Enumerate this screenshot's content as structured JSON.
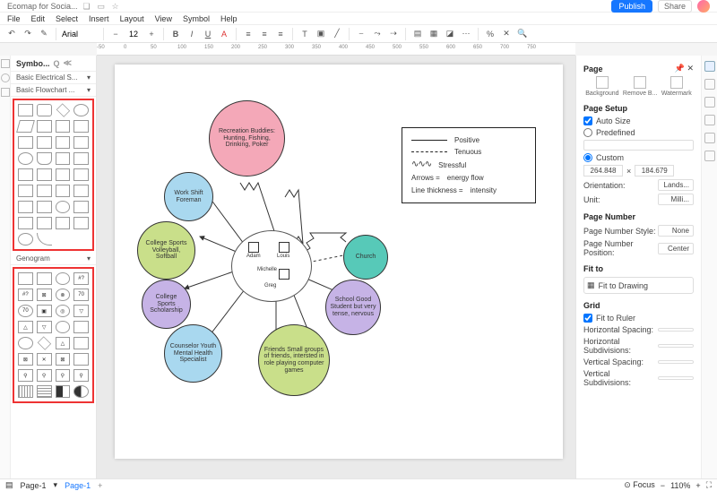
{
  "title": "Ecomap for Socia...",
  "menu": [
    "File",
    "Edit",
    "Select",
    "Insert",
    "Layout",
    "View",
    "Symbol",
    "Help"
  ],
  "toolbar": {
    "font": "Arial",
    "size": "12"
  },
  "publish": "Publish",
  "share": "Share",
  "symbols": {
    "title": "Symbo...",
    "sections": [
      "Basic Electrical S...",
      "Basic Flowchart ...",
      "Genogram"
    ]
  },
  "ruler_ticks": [
    "-50",
    "0",
    "50",
    "100",
    "150",
    "200",
    "250",
    "300",
    "350",
    "400",
    "450",
    "500",
    "550",
    "600",
    "650",
    "700",
    "750"
  ],
  "legend": {
    "positive": "Positive",
    "tenuous": "Tenuous",
    "stressful": "Stressful",
    "arrows": "Arrows =",
    "arrows_v": "energy flow",
    "thickness": "Line thickness =",
    "thickness_v": "intensity"
  },
  "nodes": {
    "recreation": "Recreation Buddies: Hunting, Fishing, Drinking, Poker",
    "workshift": "Work Shift Foreman",
    "collegesports": "College Sports Volleyball, Softball",
    "scholarship": "College Sports Scholarship",
    "counselor": "Counselor Youth Mental Health Specialist",
    "friends": "Friends Small groups of friends, intersted in role playing computer games",
    "school": "School Good Student but very tense, nervous",
    "church": "Church"
  },
  "family": {
    "adam": "Adam",
    "louis": "Louis",
    "michelle": "Michelle",
    "greg": "Greg"
  },
  "panel": {
    "title": "Page",
    "topbtns": [
      "Background",
      "Remove B...",
      "Watermark"
    ],
    "setup": "Page Setup",
    "autosize": "Auto Size",
    "predefined": "Predefined",
    "custom": "Custom",
    "w": "264.848",
    "h": "184.679",
    "orientation_l": "Orientation:",
    "orientation_v": "Lands...",
    "unit_l": "Unit:",
    "unit_v": "Milli...",
    "pagenum": "Page Number",
    "pns_l": "Page Number Style:",
    "pns_v": "None",
    "pnp_l": "Page Number Position:",
    "pnp_v": "Center",
    "fitto": "Fit to",
    "fitdraw": "Fit to Drawing",
    "grid": "Grid",
    "fitruler": "Fit to Ruler",
    "hspacing": "Horizontal Spacing:",
    "hsub": "Horizontal Subdivisions:",
    "vspacing": "Vertical Spacing:",
    "vsub": "Vertical Subdivisions:"
  },
  "status": {
    "page_l": "Page-1",
    "page_tab": "Page-1",
    "focus": "Focus",
    "zoom": "110%"
  },
  "chart_data": {
    "type": "diagram-ecomap",
    "center_family": [
      "Adam",
      "Louis",
      "Michelle",
      "Greg"
    ],
    "external_systems": [
      {
        "name": "Recreation Buddies: Hunting, Fishing, Drinking, Poker",
        "color": "#f4a8b8"
      },
      {
        "name": "Work Shift Foreman",
        "color": "#a9d8ef"
      },
      {
        "name": "College Sports Volleyball, Softball",
        "color": "#c9df8a"
      },
      {
        "name": "College Sports Scholarship",
        "color": "#c6b3e6"
      },
      {
        "name": "Counselor Youth Mental Health Specialist",
        "color": "#a9d8ef"
      },
      {
        "name": "Friends (role playing computer games)",
        "color": "#c9df8a"
      },
      {
        "name": "School Good Student but very tense, nervous",
        "color": "#c6b3e6"
      },
      {
        "name": "Church",
        "color": "#57c9b8"
      }
    ],
    "relationships": [
      {
        "from": "Adam",
        "to": "Recreation Buddies",
        "type": "stressful",
        "direction": "both"
      },
      {
        "from": "Adam",
        "to": "Work Shift Foreman",
        "type": "positive",
        "direction": "to-center"
      },
      {
        "from": "Louis",
        "to": "Recreation Buddies",
        "type": "stressful",
        "direction": "from-center"
      },
      {
        "from": "Louis",
        "to": "Church",
        "type": "stressful",
        "direction": "both"
      },
      {
        "from": "Michelle",
        "to": "College Sports",
        "type": "positive",
        "direction": "to-center"
      },
      {
        "from": "Michelle",
        "to": "Scholarship",
        "type": "positive",
        "direction": "to-center"
      },
      {
        "from": "Michelle",
        "to": "Counselor",
        "type": "positive",
        "direction": "both"
      },
      {
        "from": "Greg",
        "to": "Counselor",
        "type": "positive",
        "direction": "both"
      },
      {
        "from": "Greg",
        "to": "Friends",
        "type": "positive",
        "direction": "from-center"
      },
      {
        "from": "Greg",
        "to": "School",
        "type": "positive",
        "direction": "to-center"
      },
      {
        "from": "Greg",
        "to": "Church",
        "type": "tenuous",
        "direction": "to-center"
      }
    ],
    "legend": {
      "solid": "Positive",
      "dashed": "Tenuous",
      "zigzag": "Stressful",
      "arrows": "energy flow",
      "thickness": "intensity"
    }
  }
}
